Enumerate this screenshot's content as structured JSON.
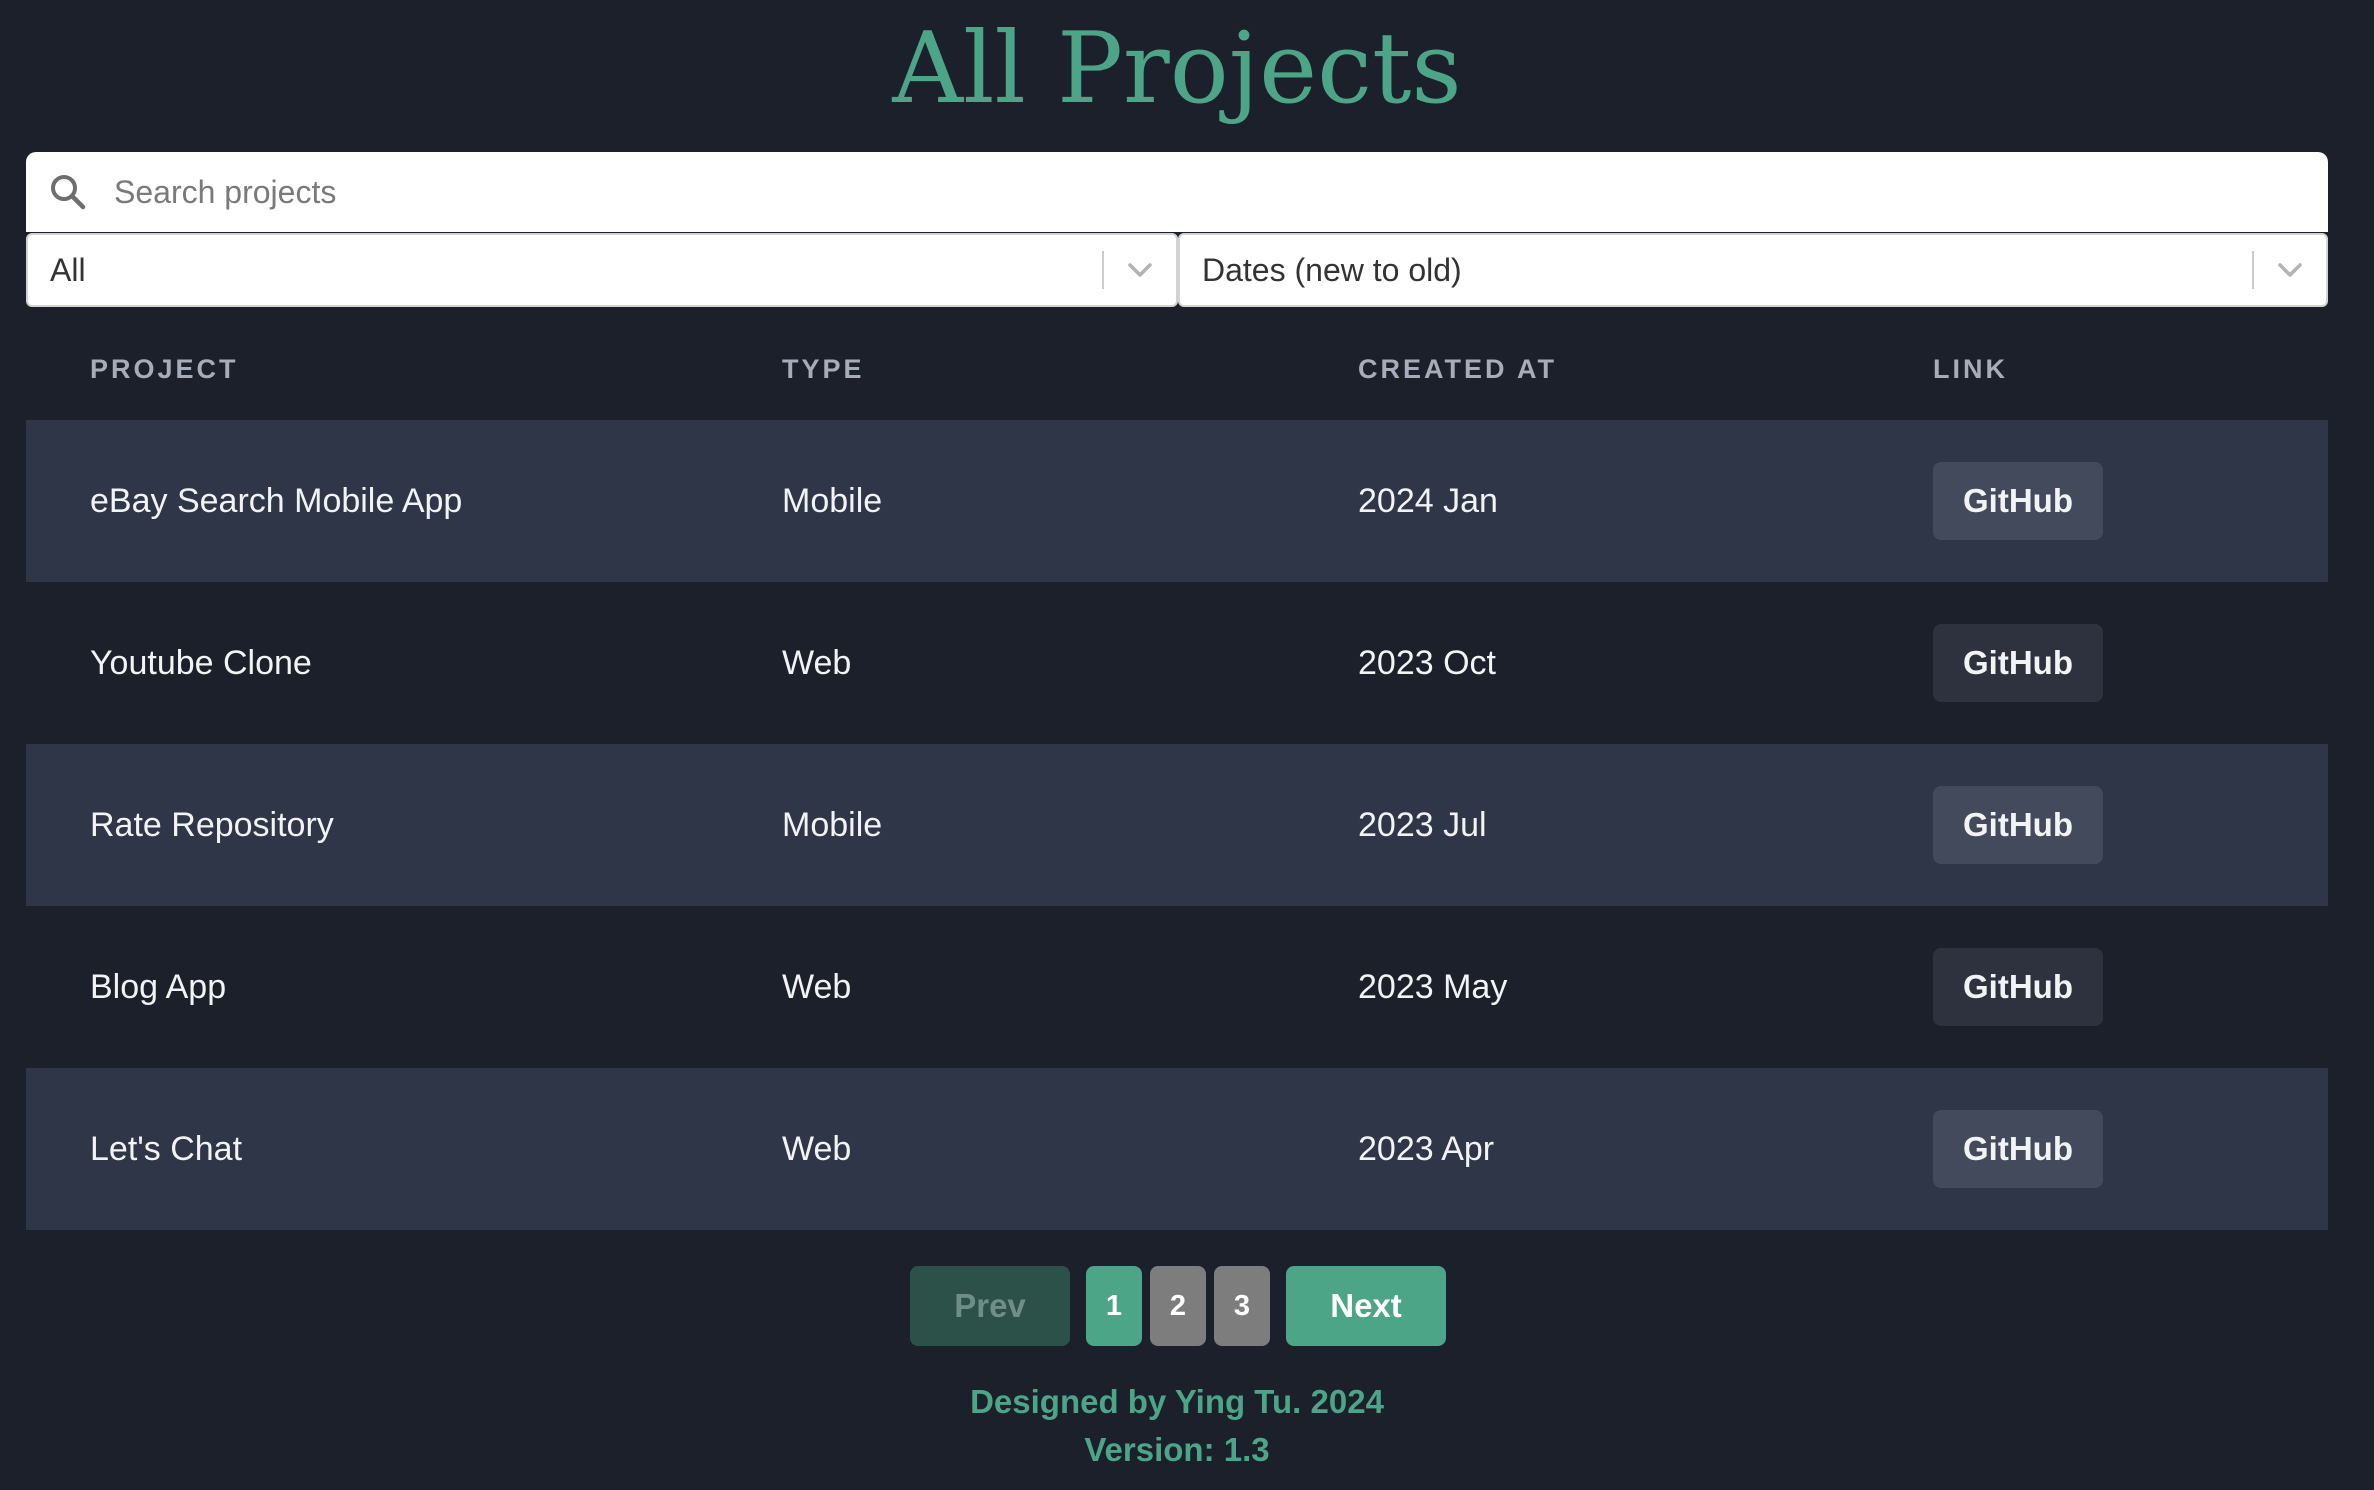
{
  "page": {
    "title": "All Projects"
  },
  "search": {
    "placeholder": "Search projects",
    "value": ""
  },
  "filters": {
    "type_selected": "All",
    "sort_selected": "Dates (new to old)"
  },
  "table": {
    "headers": [
      "PROJECT",
      "TYPE",
      "CREATED AT",
      "LINK"
    ],
    "rows": [
      {
        "project": "eBay Search Mobile App",
        "type": "Mobile",
        "created_at": "2024 Jan",
        "link_label": "GitHub"
      },
      {
        "project": "Youtube Clone",
        "type": "Web",
        "created_at": "2023 Oct",
        "link_label": "GitHub"
      },
      {
        "project": "Rate Repository",
        "type": "Mobile",
        "created_at": "2023 Jul",
        "link_label": "GitHub"
      },
      {
        "project": "Blog App",
        "type": "Web",
        "created_at": "2023 May",
        "link_label": "GitHub"
      },
      {
        "project": "Let's Chat",
        "type": "Web",
        "created_at": "2023 Apr",
        "link_label": "GitHub"
      }
    ]
  },
  "pagination": {
    "prev_label": "Prev",
    "next_label": "Next",
    "pages": [
      "1",
      "2",
      "3"
    ],
    "current_page": "1"
  },
  "footer": {
    "credit": "Designed by Ying Tu. 2024",
    "version": "Version: 1.3"
  },
  "colors": {
    "background": "#1c202b",
    "accent": "#4ca587",
    "row_alt": "#2f3647",
    "header_text": "#a5adba"
  },
  "icons": {
    "search": "search-icon",
    "select_arrow": "chevron-down-icon"
  }
}
